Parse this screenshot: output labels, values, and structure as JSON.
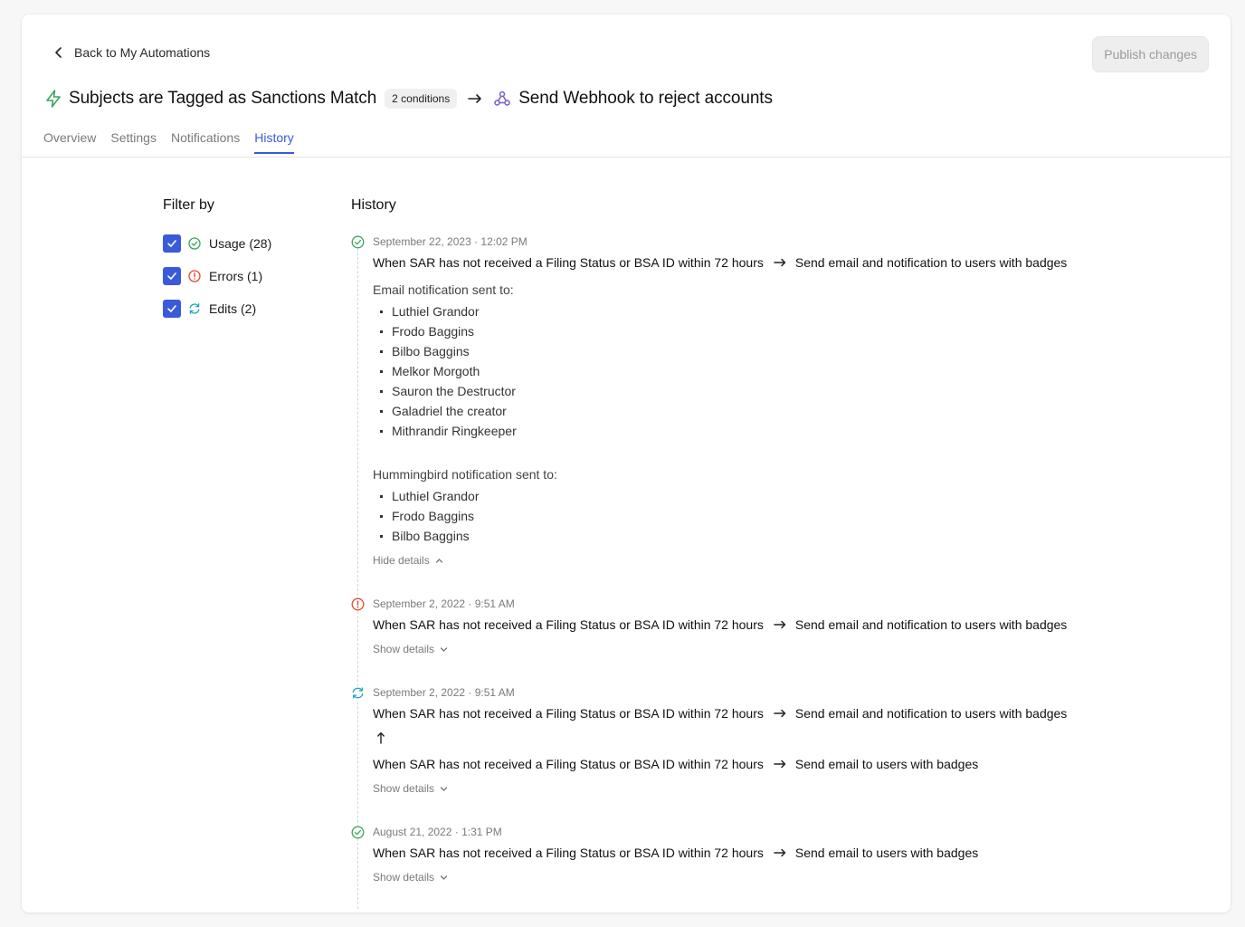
{
  "header": {
    "back_label": "Back to My Automations",
    "publish_label": "Publish changes",
    "trigger_title": "Subjects are Tagged as Sanctions Match",
    "conditions_badge": "2 conditions",
    "action_title": "Send Webhook to reject accounts",
    "icons": {
      "back": "chevron-left-icon",
      "trigger": "lightning-bolt-icon",
      "arrow": "arrow-right-icon",
      "action": "webhook-icon"
    }
  },
  "tabs": [
    {
      "label": "Overview",
      "active": false
    },
    {
      "label": "Settings",
      "active": false
    },
    {
      "label": "Notifications",
      "active": false
    },
    {
      "label": "History",
      "active": true
    }
  ],
  "filters": {
    "title": "Filter by",
    "items": [
      {
        "label": "Usage (28)",
        "checked": true,
        "icon": "check-circle-icon",
        "color": "#3aa55d"
      },
      {
        "label": "Errors (1)",
        "checked": true,
        "icon": "alert-circle-icon",
        "color": "#e5482f"
      },
      {
        "label": "Edits (2)",
        "checked": true,
        "icon": "refresh-icon",
        "color": "#1aa6c7"
      }
    ]
  },
  "history": {
    "title": "History",
    "entries": [
      {
        "type": "usage",
        "date": "September 22, 2023 · 12:02 PM",
        "condition": "When SAR has not received a Filing Status or BSA ID within 72 hours",
        "action": "Send email and notification to users with badges",
        "email_label": "Email notification sent to:",
        "email_recipients": [
          "Luthiel Grandor",
          "Frodo Baggins",
          "Bilbo Baggins",
          "Melkor Morgoth",
          "Sauron the Destructor",
          "Galadriel the creator",
          "Mithrandir Ringkeeper"
        ],
        "hummingbird_label": "Hummingbird notification sent to:",
        "hummingbird_recipients": [
          "Luthiel Grandor",
          "Frodo Baggins",
          "Bilbo Baggins"
        ],
        "toggle": "Hide details"
      },
      {
        "type": "error",
        "date": "September 2, 2022 · 9:51 AM",
        "condition": "When SAR has not received a Filing Status or BSA ID within 72 hours",
        "action": "Send email and notification to users with badges",
        "toggle": "Show details"
      },
      {
        "type": "edit",
        "date": "September 2, 2022 · 9:51 AM",
        "condition": "When SAR has not received a Filing Status or BSA ID within 72 hours",
        "action": "Send email and notification to users with badges",
        "prev_condition": "When SAR has not received a Filing Status or BSA ID within 72 hours",
        "prev_action": "Send email to users with badges",
        "toggle": "Show details"
      },
      {
        "type": "usage",
        "date": "August 21, 2022 · 1:31 PM",
        "condition": "When SAR has not received a Filing Status or BSA ID within 72 hours",
        "action": "Send email to users with badges",
        "toggle": "Show details"
      }
    ]
  },
  "colors": {
    "accent": "#3a5bd9",
    "success": "#3aa55d",
    "error": "#e5482f",
    "edit": "#1aa6c7",
    "webhook": "#7b5cc4"
  }
}
